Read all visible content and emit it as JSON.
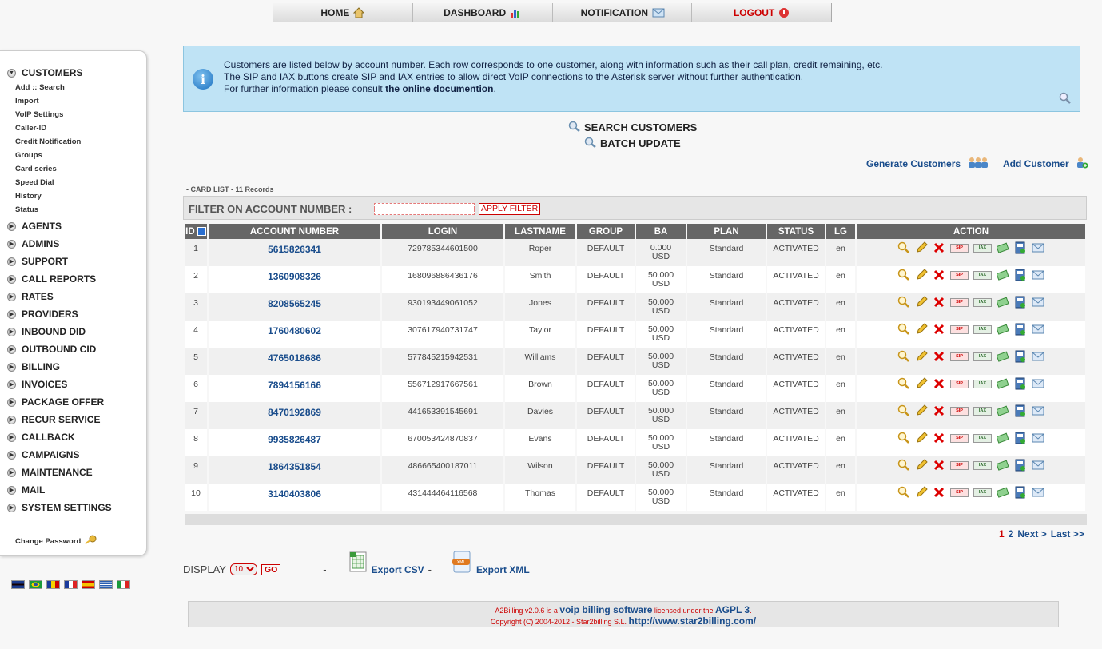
{
  "nav": {
    "home": "HOME",
    "dashboard": "DASHBOARD",
    "notification": "NOTIFICATION",
    "logout": "LOGOUT"
  },
  "sidebar": {
    "customers": "CUSTOMERS",
    "submenu": [
      "Add :: Search",
      "Import",
      "VoIP Settings",
      "Caller-ID",
      "Credit Notification",
      "Groups",
      "Card series",
      "Speed Dial",
      "History",
      "Status"
    ],
    "menus": [
      "AGENTS",
      "ADMINS",
      "SUPPORT",
      "CALL REPORTS",
      "RATES",
      "PROVIDERS",
      "INBOUND DID",
      "OUTBOUND CID",
      "BILLING",
      "INVOICES",
      "PACKAGE OFFER",
      "RECUR SERVICE",
      "CALLBACK",
      "CAMPAIGNS",
      "MAINTENANCE",
      "MAIL",
      "SYSTEM SETTINGS"
    ],
    "change_password": "Change Password"
  },
  "info": {
    "line1": "Customers are listed below by account number. Each row corresponds to one customer, along with information such as their call plan, credit remaining, etc.",
    "line2": "The SIP and IAX buttons create SIP and IAX entries to allow direct VoIP connections to the Asterisk server without further authentication.",
    "line3_prefix": "For further information please consult ",
    "line3_link": "the online documention",
    "line3_suffix": "."
  },
  "links": {
    "search": "SEARCH CUSTOMERS",
    "batch": "BATCH UPDATE",
    "generate": "Generate Customers",
    "add": "Add Customer"
  },
  "card_list": "- CARD LIST - 11 Records",
  "filter": {
    "label": "FILTER ON ACCOUNT NUMBER :",
    "value": "",
    "button": "APPLY FILTER"
  },
  "table": {
    "headers": [
      "ID",
      "ACCOUNT NUMBER",
      "LOGIN",
      "LASTNAME",
      "GROUP",
      "BA",
      "PLAN",
      "STATUS",
      "LG",
      "ACTION"
    ],
    "rows": [
      {
        "id": "1",
        "account": "5615826341",
        "login": "729785344601500",
        "lastname": "Roper",
        "group": "DEFAULT",
        "ba": "0.000",
        "cur": "USD",
        "plan": "Standard",
        "status": "ACTIVATED",
        "lg": "en"
      },
      {
        "id": "2",
        "account": "1360908326",
        "login": "168096886436176",
        "lastname": "Smith",
        "group": "DEFAULT",
        "ba": "50.000",
        "cur": "USD",
        "plan": "Standard",
        "status": "ACTIVATED",
        "lg": "en"
      },
      {
        "id": "3",
        "account": "8208565245",
        "login": "930193449061052",
        "lastname": "Jones",
        "group": "DEFAULT",
        "ba": "50.000",
        "cur": "USD",
        "plan": "Standard",
        "status": "ACTIVATED",
        "lg": "en"
      },
      {
        "id": "4",
        "account": "1760480602",
        "login": "307617940731747",
        "lastname": "Taylor",
        "group": "DEFAULT",
        "ba": "50.000",
        "cur": "USD",
        "plan": "Standard",
        "status": "ACTIVATED",
        "lg": "en"
      },
      {
        "id": "5",
        "account": "4765018686",
        "login": "577845215942531",
        "lastname": "Williams",
        "group": "DEFAULT",
        "ba": "50.000",
        "cur": "USD",
        "plan": "Standard",
        "status": "ACTIVATED",
        "lg": "en"
      },
      {
        "id": "6",
        "account": "7894156166",
        "login": "556712917667561",
        "lastname": "Brown",
        "group": "DEFAULT",
        "ba": "50.000",
        "cur": "USD",
        "plan": "Standard",
        "status": "ACTIVATED",
        "lg": "en"
      },
      {
        "id": "7",
        "account": "8470192869",
        "login": "441653391545691",
        "lastname": "Davies",
        "group": "DEFAULT",
        "ba": "50.000",
        "cur": "USD",
        "plan": "Standard",
        "status": "ACTIVATED",
        "lg": "en"
      },
      {
        "id": "8",
        "account": "9935826487",
        "login": "670053424870837",
        "lastname": "Evans",
        "group": "DEFAULT",
        "ba": "50.000",
        "cur": "USD",
        "plan": "Standard",
        "status": "ACTIVATED",
        "lg": "en"
      },
      {
        "id": "9",
        "account": "1864351854",
        "login": "486665400187011",
        "lastname": "Wilson",
        "group": "DEFAULT",
        "ba": "50.000",
        "cur": "USD",
        "plan": "Standard",
        "status": "ACTIVATED",
        "lg": "en"
      },
      {
        "id": "10",
        "account": "3140403806",
        "login": "431444464116568",
        "lastname": "Thomas",
        "group": "DEFAULT",
        "ba": "50.000",
        "cur": "USD",
        "plan": "Standard",
        "status": "ACTIVATED",
        "lg": "en"
      }
    ],
    "action_labels": {
      "sip": "SIP",
      "iax": "IAX"
    }
  },
  "pager": {
    "current": "1",
    "page2": "2",
    "next": "Next >",
    "last": "Last >>"
  },
  "display": {
    "label": "DISPLAY",
    "value": "10",
    "go": "GO",
    "sep": "-",
    "csv": "Export CSV",
    "sep2": "-",
    "xml": "Export XML"
  },
  "footer": {
    "l1_a": "A2Billing v2.0.6 is a ",
    "l1_b": "voip billing software",
    "l1_c": " licensed under the ",
    "l1_d": "AGPL 3",
    "l1_e": ".",
    "l2_a": "Copyright (C) 2004-2012 - Star2billing S.L. ",
    "l2_b": "http://www.star2billing.com/"
  },
  "colors": {
    "accent": "#1a4d8c",
    "danger": "#cc0000",
    "info_bg": "#bfe3f5",
    "header_bg": "#666666"
  }
}
